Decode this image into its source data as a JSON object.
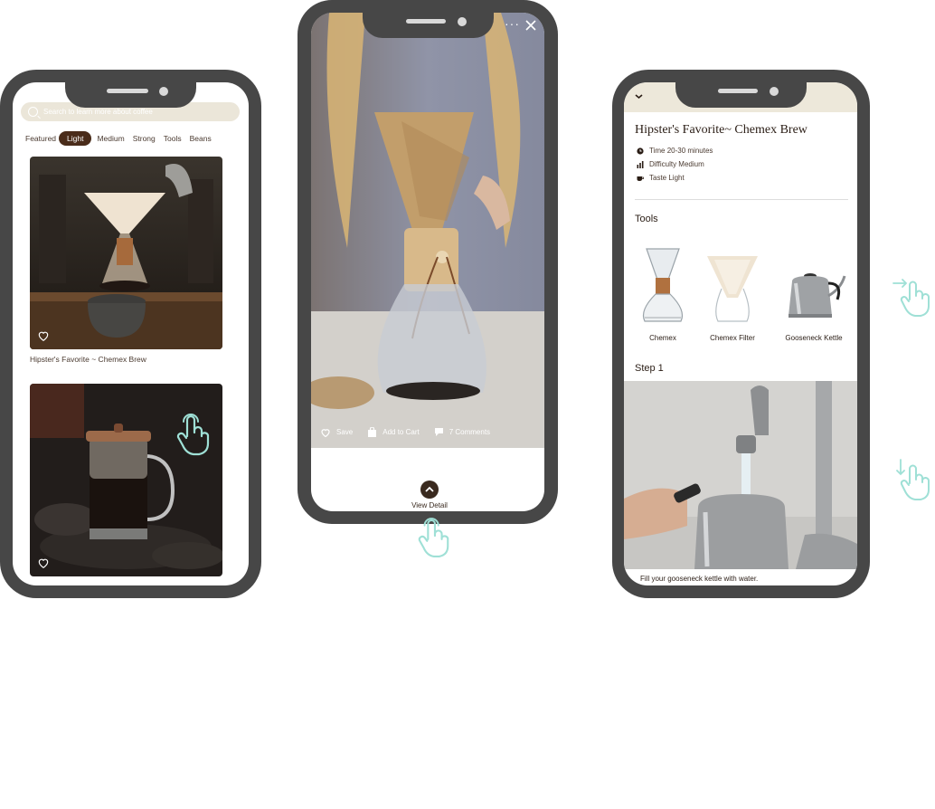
{
  "phone1": {
    "search": {
      "placeholder": "Search to learn more about coffee"
    },
    "tabs": [
      "Featured",
      "Light",
      "Medium",
      "Strong",
      "Tools",
      "Beans"
    ],
    "active_tab": "Light",
    "cards": [
      {
        "title": "Hipster's Favorite ~ Chemex Brew",
        "icon": "heart-icon"
      },
      {
        "title": "",
        "icon": "heart-icon"
      }
    ]
  },
  "phone2": {
    "actions": {
      "save": "Save",
      "cart": "Add to Cart",
      "comments": "7 Comments"
    },
    "view_detail": "View Detail"
  },
  "phone3": {
    "title": "Hipster's Favorite~ Chemex Brew",
    "meta": {
      "time": "Time  20-30 minutes",
      "difficulty": "Difficulty  Medium",
      "taste": "Taste  Light"
    },
    "tools_heading": "Tools",
    "tools": [
      "Chemex",
      "Chemex Filter",
      "Gooseneck Kettle"
    ],
    "step_heading": "Step 1",
    "step_text": "Fill your gooseneck kettle with water."
  },
  "colors": {
    "frame": "#474747",
    "accent_brown": "#4a2c1a",
    "search_bg": "#ebe6d9",
    "header_cream": "#ede8da",
    "gesture": "#9fe0d6"
  }
}
